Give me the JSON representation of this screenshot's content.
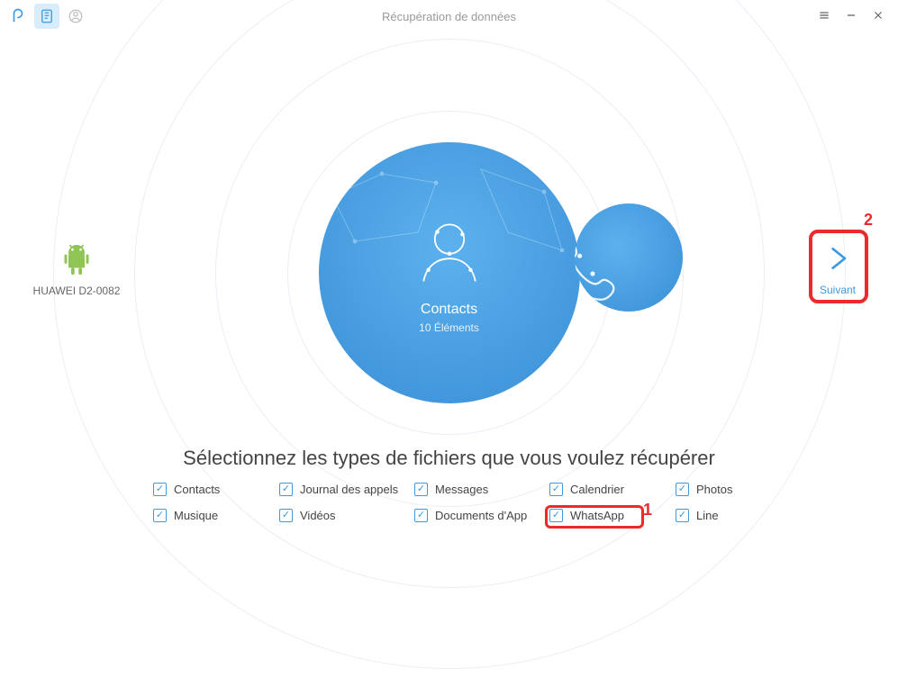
{
  "header": {
    "title": "Récupération de données"
  },
  "device": {
    "name": "HUAWEI D2-0082"
  },
  "centerCircle": {
    "title": "Contacts",
    "subtitle": "10 Éléments"
  },
  "nextButton": {
    "label": "Suivant"
  },
  "instruction": "Sélectionnez les types de fichiers que vous voulez récupérer",
  "types": {
    "row1": [
      {
        "label": "Contacts",
        "checked": true
      },
      {
        "label": "Journal des appels",
        "checked": true
      },
      {
        "label": "Messages",
        "checked": true
      },
      {
        "label": "Calendrier",
        "checked": true
      },
      {
        "label": "Photos",
        "checked": true
      }
    ],
    "row2": [
      {
        "label": "Musique",
        "checked": true
      },
      {
        "label": "Vidéos",
        "checked": true
      },
      {
        "label": "Documents d'App",
        "checked": true
      },
      {
        "label": "WhatsApp",
        "checked": true
      },
      {
        "label": "Line",
        "checked": true
      }
    ]
  },
  "annotations": {
    "num1": "1",
    "num2": "2"
  }
}
